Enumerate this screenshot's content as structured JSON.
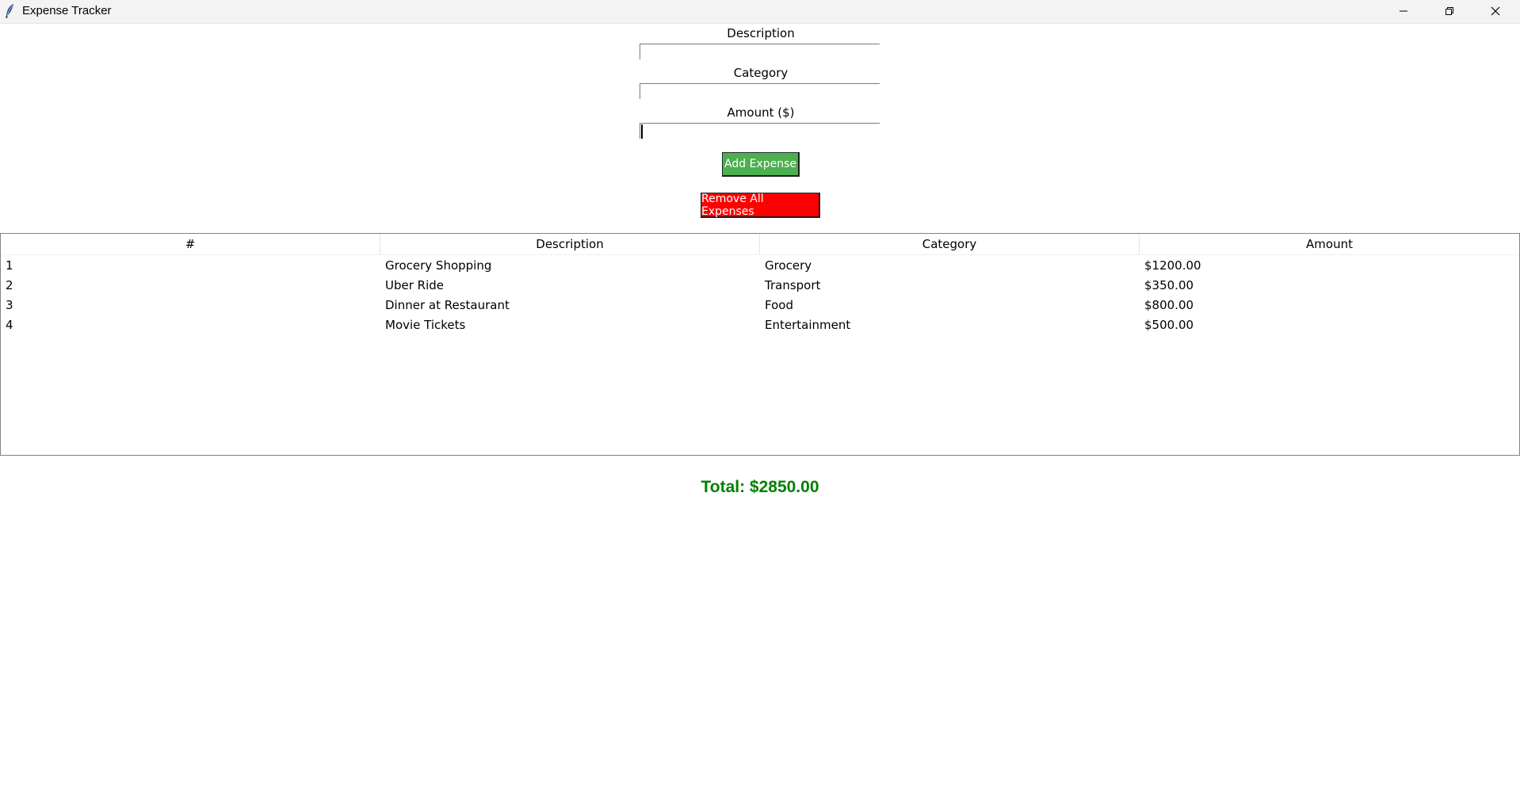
{
  "window": {
    "title": "Expense Tracker",
    "controls": {
      "minimize_icon": "minimize-icon",
      "maximize_icon": "restore-icon",
      "close_icon": "close-icon"
    }
  },
  "form": {
    "description_label": "Description",
    "description_value": "",
    "category_label": "Category",
    "category_value": "",
    "amount_label": "Amount ($)",
    "amount_value": "",
    "add_button": "Add Expense",
    "remove_button": "Remove All Expenses"
  },
  "colors": {
    "add_button_bg": "#4caf50",
    "remove_button_bg": "#ff0000",
    "total_text": "#008000"
  },
  "table": {
    "columns": [
      "#",
      "Description",
      "Category",
      "Amount"
    ],
    "rows": [
      [
        "1",
        "Grocery Shopping",
        "Grocery",
        "$1200.00"
      ],
      [
        "2",
        "Uber Ride",
        "Transport",
        "$350.00"
      ],
      [
        "3",
        "Dinner at Restaurant",
        "Food",
        "$800.00"
      ],
      [
        "4",
        "Movie Tickets",
        "Entertainment",
        "$500.00"
      ]
    ]
  },
  "summary": {
    "total": "Total: $2850.00"
  }
}
